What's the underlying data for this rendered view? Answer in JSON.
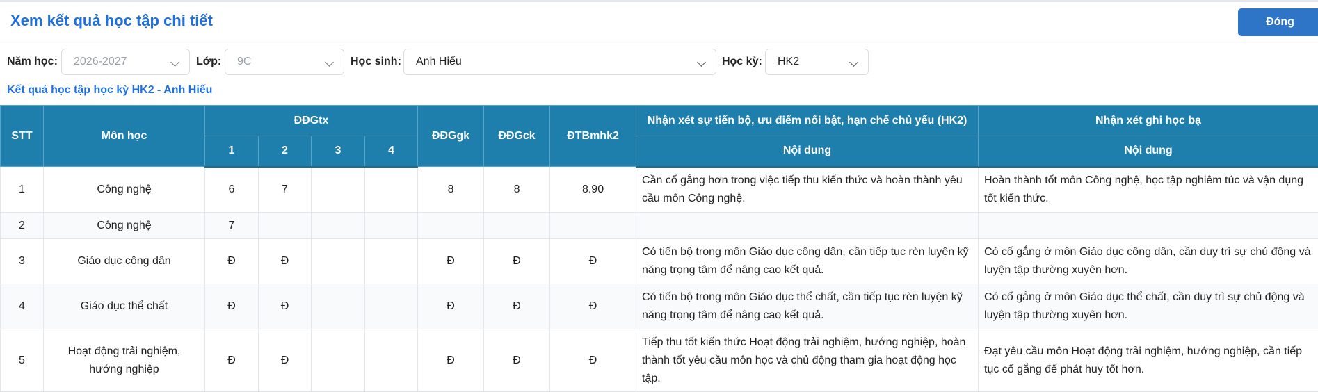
{
  "header": {
    "title": "Xem kết quả học tập chi tiết",
    "close_label": "Đóng"
  },
  "filters": {
    "year_label": "Năm học:",
    "year_value": "2026-2027",
    "class_label": "Lớp:",
    "class_value": "9C",
    "student_label": "Học sinh:",
    "student_value": "Anh Hiếu",
    "term_label": "Học kỳ:",
    "term_value": "HK2"
  },
  "subtitle": "Kết quả học tập học kỳ HK2 - Anh Hiếu",
  "table": {
    "headers": {
      "stt": "STT",
      "subject": "Môn học",
      "ddgtx": "ĐĐGtx",
      "ddgtx_cols": [
        "1",
        "2",
        "3",
        "4"
      ],
      "ddggk": "ĐĐGgk",
      "ddgck": "ĐĐGck",
      "dtb": "ĐTBmhk2",
      "comment_progress": "Nhận xét sự tiến bộ, ưu điểm nổi bật, hạn chế chủ yếu (HK2)",
      "comment_record": "Nhận xét ghi học bạ",
      "content": "Nội dung",
      "content2": "Nội dung"
    },
    "rows": [
      {
        "stt": "1",
        "subject": "Công nghệ",
        "tx": [
          "6",
          "7",
          "",
          ""
        ],
        "gk": "8",
        "ck": "8",
        "tb": "8.90",
        "comment": "Cần cố gắng hơn trong việc tiếp thu kiến thức và hoàn thành yêu cầu môn Công nghệ.",
        "record": "Hoàn thành tốt môn Công nghệ, học tập nghiêm túc và vận dụng tốt kiến thức."
      },
      {
        "stt": "2",
        "subject": "Công nghệ",
        "tx": [
          "7",
          "",
          "",
          ""
        ],
        "gk": "",
        "ck": "",
        "tb": "",
        "comment": "",
        "record": ""
      },
      {
        "stt": "3",
        "subject": "Giáo dục công dân",
        "tx": [
          "Đ",
          "Đ",
          "",
          ""
        ],
        "gk": "Đ",
        "ck": "Đ",
        "tb": "Đ",
        "comment": "Có tiến bộ trong môn Giáo dục công dân, cần tiếp tục rèn luyện kỹ năng trọng tâm để nâng cao kết quả.",
        "record": "Có cố gắng ở môn Giáo dục công dân, cần duy trì sự chủ động và luyện tập thường xuyên hơn."
      },
      {
        "stt": "4",
        "subject": "Giáo dục thể chất",
        "tx": [
          "Đ",
          "Đ",
          "",
          ""
        ],
        "gk": "Đ",
        "ck": "Đ",
        "tb": "Đ",
        "comment": "Có tiến bộ trong môn Giáo dục thể chất, cần tiếp tục rèn luyện kỹ năng trọng tâm để nâng cao kết quả.",
        "record": "Có cố gắng ở môn Giáo dục thể chất, cần duy trì sự chủ động và luyện tập thường xuyên hơn."
      },
      {
        "stt": "5",
        "subject": "Hoạt động trải nghiệm, hướng nghiệp",
        "tx": [
          "Đ",
          "Đ",
          "",
          ""
        ],
        "gk": "Đ",
        "ck": "Đ",
        "tb": "Đ",
        "comment": "Tiếp thu tốt kiến thức Hoạt động trải nghiệm, hướng nghiệp, hoàn thành tốt yêu cầu môn học và chủ động tham gia hoạt động học tập.",
        "record": "Đạt yêu cầu môn Hoạt động trải nghiệm, hướng nghiệp, cần tiếp tục cố gắng để phát huy tốt hơn."
      }
    ]
  }
}
